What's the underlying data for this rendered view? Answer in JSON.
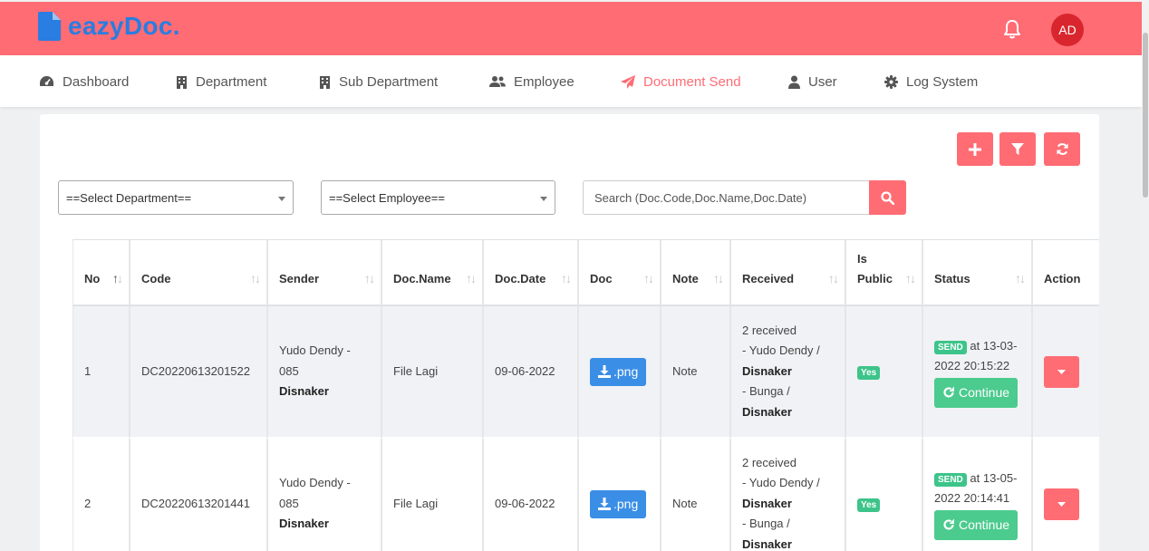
{
  "header": {
    "brand": "eazyDoc.",
    "avatar_initials": "AD",
    "colors": {
      "topbar": "#ff6c74",
      "brand": "#2a7de1",
      "avatar": "#d9262e"
    }
  },
  "nav": {
    "items": [
      {
        "label": "Dashboard",
        "icon": "dashboard-icon"
      },
      {
        "label": "Department",
        "icon": "building-icon"
      },
      {
        "label": "Sub Department",
        "icon": "building-icon"
      },
      {
        "label": "Employee",
        "icon": "users-icon"
      },
      {
        "label": "Document Send",
        "icon": "paper-plane-icon",
        "active": true
      },
      {
        "label": "User",
        "icon": "user-icon"
      },
      {
        "label": "Log System",
        "icon": "gear-icon"
      }
    ]
  },
  "filters": {
    "department_select": "==Select Department==",
    "employee_select": "==Select Employee==",
    "search_placeholder": "Search (Doc.Code,Doc.Name,Doc.Date)"
  },
  "table": {
    "columns": [
      "No",
      "Code",
      "Sender",
      "Doc.Name",
      "Doc.Date",
      "Doc",
      "Note",
      "Received",
      "Is Public",
      "Status",
      "Action"
    ],
    "is_public_line1": "Is",
    "is_public_line2": "Public",
    "rows": [
      {
        "no": "1",
        "code": "DC20220613201522",
        "sender_name": "Yudo Dendy -",
        "sender_phone": "085",
        "sender_dept": "Disnaker",
        "doc_name": "File Lagi",
        "doc_date": "09-06-2022",
        "doc_button": ".png",
        "note": "Note",
        "received_count": "2 received",
        "received_1_name": "- Yudo Dendy /",
        "received_1_dept": "Disnaker",
        "received_2_name": "- Bunga /",
        "received_2_dept": "Disnaker",
        "is_public": "Yes",
        "status_badge": "SEND",
        "status_text_1": " at 13-03-",
        "status_text_2": "2022 20:15:22",
        "continue_label": "Continue"
      },
      {
        "no": "2",
        "code": "DC20220613201441",
        "sender_name": "Yudo Dendy -",
        "sender_phone": "085",
        "sender_dept": "Disnaker",
        "doc_name": "File Lagi",
        "doc_date": "09-06-2022",
        "doc_button": ".png",
        "note": "Note",
        "received_count": "2 received",
        "received_1_name": "- Yudo Dendy /",
        "received_1_dept": "Disnaker",
        "received_2_name": "- Bunga /",
        "received_2_dept": "Disnaker",
        "is_public": "Yes",
        "status_badge": "SEND",
        "status_text_1": " at 13-05-",
        "status_text_2": "2022 20:14:41",
        "continue_label": "Continue"
      }
    ]
  }
}
